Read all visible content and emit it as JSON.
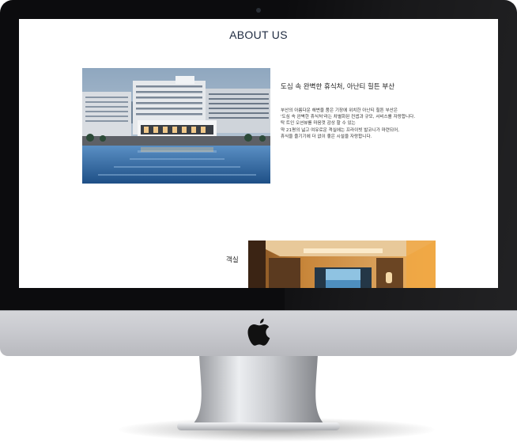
{
  "page": {
    "title": "ABOUT US"
  },
  "intro": {
    "heading": "도심 속 완벽한 휴식처, 아난티 힐튼 부산",
    "body_lines": [
      "부산의 아름다운 해변을 품은 기장에 위치한 아난티 힐튼 부산은",
      "'도심 속 완벽한 휴식처'라는 차별화된 컨셉과 규모, 서비스를 자랑합니다.",
      "탁 트인 오션뷰를 마음껏 감상 할 수 있는",
      "약 21평의 넓고 여유로운 객실에는 프라이빗 발코니가 마련되어,",
      "휴식을 즐기기에 더 없이 좋은 시설을 자랑합니다."
    ]
  },
  "rooms": {
    "label": "객실"
  },
  "colors": {
    "bezel": "#0c0c0e",
    "chin": "#c9cacf",
    "title_text": "#1e2a40",
    "pool_blue": "#2f6fb0",
    "room_gold": "#c8863a"
  },
  "icons": {
    "camera": "camera-dot-icon",
    "logo": "apple-logo-icon"
  }
}
